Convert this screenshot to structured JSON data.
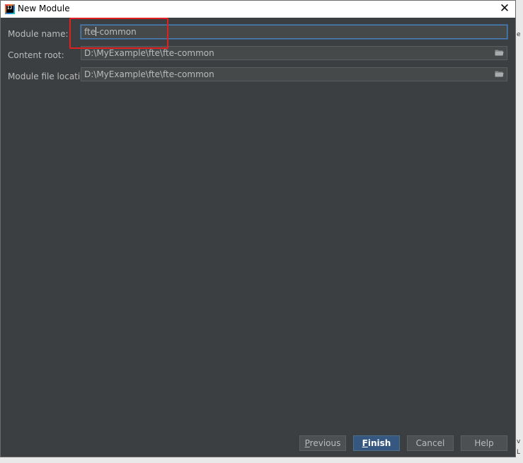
{
  "window": {
    "title": "New Module",
    "close_symbol": "✕",
    "app_icon_text": "IJ"
  },
  "form": {
    "module_name": {
      "label": "Module name:",
      "value_before_caret": "fte",
      "value_after_caret": "common",
      "separator": "-"
    },
    "content_root": {
      "label": "Content root:",
      "value": "D:\\MyExample\\fte\\fte-common"
    },
    "module_file_location": {
      "label": "Module file location:",
      "value": "D:\\MyExample\\fte\\fte-common"
    }
  },
  "buttons": {
    "previous": {
      "mnemonic": "P",
      "rest": "revious"
    },
    "finish": {
      "mnemonic": "F",
      "rest": "inish"
    },
    "cancel": {
      "label": "Cancel"
    },
    "help": {
      "label": "Help"
    }
  },
  "background_edge": {
    "char_top": "e",
    "char_mid": "v",
    "char_bottom": "L"
  },
  "icons": {
    "browse": "folder-icon",
    "close": "close-icon",
    "app": "intellij-icon"
  },
  "colors": {
    "dialog_bg": "#3c3f41",
    "field_bg": "#45494a",
    "focus_border": "#4a7fb8",
    "primary_button": "#365880",
    "annotation_red": "#e02020"
  }
}
